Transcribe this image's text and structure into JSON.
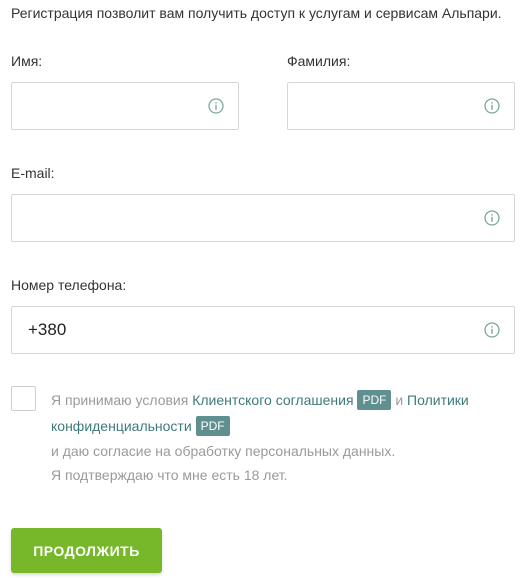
{
  "intro_text": "Регистрация позволит вам получить доступ к услугам и сервисам Альпари.",
  "fields": {
    "first_name": {
      "label": "Имя:",
      "value": ""
    },
    "last_name": {
      "label": "Фамилия:",
      "value": ""
    },
    "email": {
      "label": "E-mail:",
      "value": ""
    },
    "phone": {
      "label": "Номер телефона:",
      "value": "+380"
    }
  },
  "consent": {
    "text_before": "Я принимаю условия",
    "client_agreement_link": "Клиентского соглашения",
    "pdf_label": "PDF",
    "and": "и",
    "privacy_link_part1": "Политики",
    "privacy_link_part2": "конфиденциальности",
    "line_personal_data": "и даю согласие на обработку персональных данных.",
    "line_age": "Я подтверждаю что мне есть 18 лет.",
    "checked": false
  },
  "submit_label": "ПРОДОЛЖИТЬ",
  "colors": {
    "accent_green": "#76b82a",
    "link_teal": "#3e7a7a",
    "pdf_badge": "#5f8f8f",
    "info_icon": "#7aaa9a"
  },
  "icons": {
    "field_info": "info-circle-icon"
  }
}
